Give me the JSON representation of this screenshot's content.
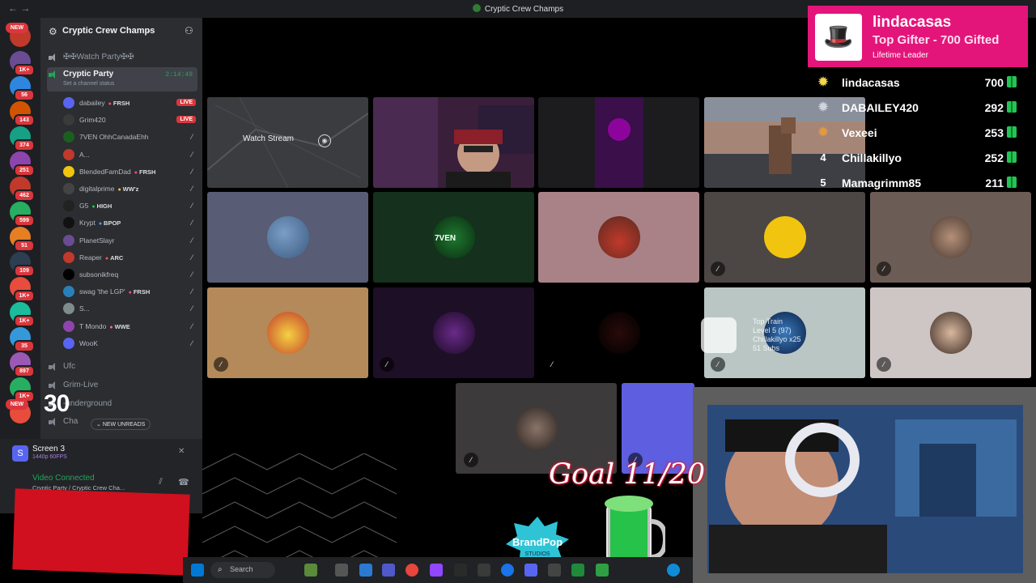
{
  "window": {
    "title": "Cryptic Crew Champs"
  },
  "rail": {
    "badges": [
      {
        "label": "NEW",
        "color": "#da373c"
      },
      {
        "label": "1K+"
      },
      {
        "label": "56"
      },
      {
        "label": "143"
      },
      {
        "label": "374"
      },
      {
        "label": "251"
      },
      {
        "label": "462"
      },
      {
        "label": "599"
      },
      {
        "label": "51"
      },
      {
        "label": "109"
      },
      {
        "label": "1K+"
      },
      {
        "label": "1K+"
      },
      {
        "label": "35"
      },
      {
        "label": "897"
      },
      {
        "label": "1K+"
      },
      {
        "label": "NEW"
      }
    ]
  },
  "sidebar": {
    "server_name": "Cryptic Crew Champs",
    "channels_top": [
      {
        "label": "✠✠Watch Party✠✠"
      }
    ],
    "active_channel": {
      "label": "Cryptic Party",
      "status_placeholder": "Set a channel status",
      "timer": "2:14:49"
    },
    "members": [
      {
        "name": "dabailey",
        "tag": "FRSH",
        "live": "LIVE",
        "color": "#5865f2"
      },
      {
        "name": "Grim420",
        "tag": "",
        "live": "LIVE",
        "color": "#3a3a3a"
      },
      {
        "name": "7VEN OhhCanadaEhh",
        "tag": "",
        "live": "",
        "color": "#1b5e20"
      },
      {
        "name": "A...",
        "tag": "",
        "live": "",
        "color": "#c0392b"
      },
      {
        "name": "BlendedFamDad",
        "tag": "FRSH",
        "live": "",
        "color": "#f1c40f"
      },
      {
        "name": "digitalprime",
        "tag": "WW'z",
        "live": "",
        "color": "#444"
      },
      {
        "name": "G5",
        "tag": "HIGH",
        "live": "",
        "color": "#222"
      },
      {
        "name": "Krypt",
        "tag": "BPOP",
        "live": "",
        "color": "#111"
      },
      {
        "name": "PlanetSlayr",
        "tag": "",
        "live": "",
        "color": "#6a4c93"
      },
      {
        "name": "Reaper",
        "tag": "ARC",
        "live": "",
        "color": "#c0392b"
      },
      {
        "name": "subsonikfreq",
        "tag": "",
        "live": "",
        "color": "#000"
      },
      {
        "name": "swag 'the LGP'",
        "tag": "FRSH",
        "live": "",
        "color": "#2980b9"
      },
      {
        "name": "S...",
        "tag": "",
        "live": "",
        "color": "#7f8c8d"
      },
      {
        "name": "T Mondo",
        "tag": "WWE",
        "live": "",
        "color": "#8e44ad"
      },
      {
        "name": "WooK",
        "tag": "",
        "live": "",
        "color": "#5865f2"
      }
    ],
    "channels_bottom": [
      {
        "label": "Ufc"
      },
      {
        "label": "Grim-Live"
      },
      {
        "label": "-underground"
      },
      {
        "label": "Cha"
      }
    ],
    "new_unreads": "NEW UNREADS",
    "overlay_counter": "30"
  },
  "voice_panel": {
    "screen_name": "Screen 3",
    "screen_res": "1440p 60FPS",
    "status": "Video Connected",
    "channel_path": "Cryptic Party / Cryptic Crew Cha..."
  },
  "stage": {
    "watch_stream": "Watch Stream"
  },
  "top_gifter": {
    "name": "lindacasas",
    "subtitle": "Top Gifter - 700 Gifted",
    "lead": "Lifetime Leader"
  },
  "leaderboard": [
    {
      "rank": "",
      "name": "lindacasas",
      "count": "700",
      "medal": "gold"
    },
    {
      "rank": "",
      "name": "DABAILEY420",
      "count": "292",
      "medal": "silver"
    },
    {
      "rank": "",
      "name": "Vexeei",
      "count": "253",
      "medal": "bronze"
    },
    {
      "rank": "4",
      "name": "Chillakillyo",
      "count": "252",
      "medal": ""
    },
    {
      "rank": "5",
      "name": "Mamagrimm85",
      "count": "211",
      "medal": ""
    }
  ],
  "hype_train": {
    "line1": "Top Train",
    "line2": "Level 5 (97)",
    "line3": "Chillakillyo x25",
    "line4": "51 Subs"
  },
  "goal": {
    "text": "Goal 11/20",
    "current": 11,
    "target": 20
  },
  "taskbar": {
    "search_placeholder": "Search"
  },
  "colors": {
    "rail_bg": "#1e1f22",
    "sidebar_bg": "#2b2d31",
    "live_red": "#da373c",
    "connected_green": "#23a55a",
    "gifter_pink": "#e4157a"
  }
}
